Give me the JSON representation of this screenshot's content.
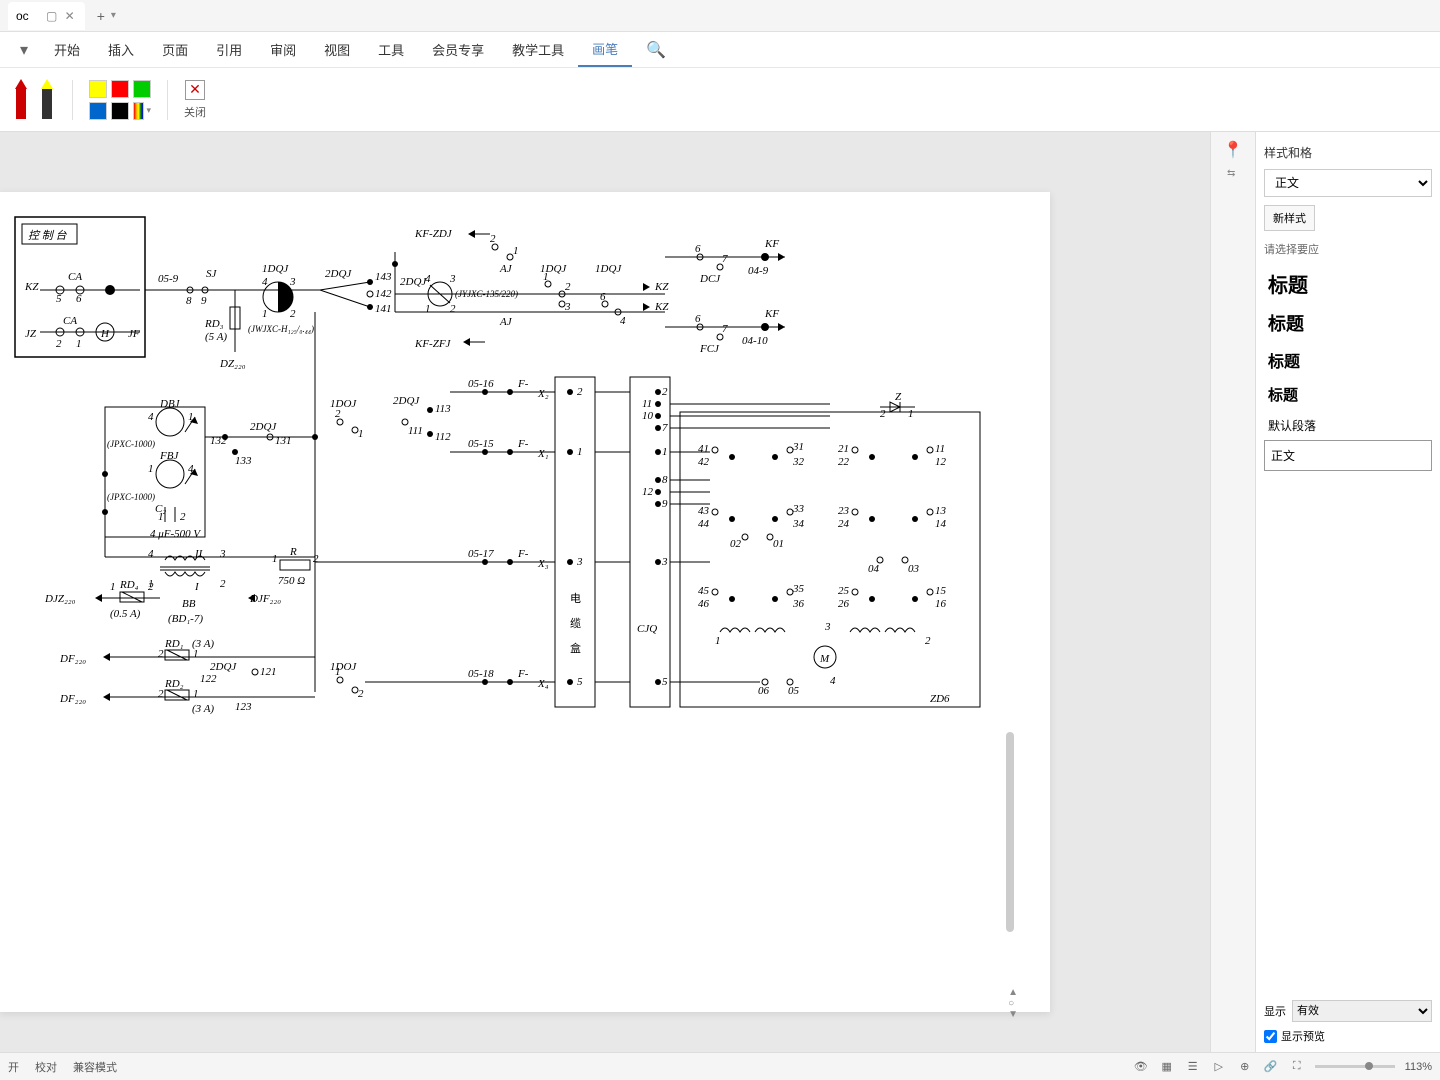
{
  "titlebar": {
    "tab_name": "oc",
    "window_minimize": "▢",
    "window_close": "✕",
    "new_tab": "+",
    "tab_menu": "▾"
  },
  "menubar": {
    "dropdown": "▾",
    "items": [
      "开始",
      "插入",
      "页面",
      "引用",
      "审阅",
      "视图",
      "工具",
      "会员专享",
      "教学工具",
      "画笔"
    ],
    "active_index": 9,
    "search": "🔍"
  },
  "toolbar": {
    "pens": [
      {
        "name": "red-pen",
        "tip": "#c00",
        "body": "#c00"
      },
      {
        "name": "highlighter",
        "tip": "#ff0",
        "body": "#333"
      }
    ],
    "colors_row1": [
      "#ffff00",
      "#ff0000",
      "#00cc00"
    ],
    "colors_row2": [
      "#0066cc",
      "#000000"
    ],
    "close_label": "关闭"
  },
  "style_panel": {
    "title": "样式和格",
    "current_style": "正文",
    "new_style_btn": "新样式",
    "hint": "请选择要应",
    "styles": [
      {
        "label": "标题",
        "cls": "h1"
      },
      {
        "label": "标题",
        "cls": "h2"
      },
      {
        "label": "标题",
        "cls": "h3"
      },
      {
        "label": "标题",
        "cls": "h4"
      },
      {
        "label": "默认段落",
        "cls": "normal"
      },
      {
        "label": "正文",
        "cls": "body"
      }
    ],
    "show_label": "显示",
    "show_value": "有效",
    "preview_cb": "显示预览",
    "preview_checked": true
  },
  "statusbar": {
    "items": [
      "开",
      "校对",
      "兼容模式"
    ],
    "zoom": "113%"
  },
  "schematic": {
    "title_box": "控 制 台",
    "labels": {
      "kz": "KZ",
      "ca": "CA",
      "jz": "JZ",
      "jf": "JF",
      "h": "H",
      "sj": "SJ",
      "rd3": "RD₃",
      "rd3_5a": "(5 A)",
      "dz220": "DZ₂₂₀",
      "jwjxc": "(JWJXC-H₁₂₅/₀.₄₄)",
      "kf_zdj": "KF-ZDJ",
      "kf_zfj": "KF-ZFJ",
      "aj": "AJ",
      "dcj": "DCJ",
      "fcj": "FCJ",
      "kf": "KF",
      "dqj1": "1DQJ",
      "dqj2": "2DQJ",
      "doj": "1DOJ",
      "jyjxc": "(JYJXC-135/220)",
      "dbj": "DBJ",
      "fbj": "FBJ",
      "jpxc": "(JPXC-1000)",
      "c2": "C₂",
      "cap": "4 μF-500 V",
      "bb": "BB",
      "bd17": "(BD₁-7)",
      "r": "R",
      "r_val": "750 Ω",
      "djz": "DJZ₂₂₀",
      "djf": "DJF₂₂₀",
      "rd4": "RD₄",
      "rd4_05a": "(0.5 A)",
      "df220": "DF₂₂₀",
      "rd1": "RD₁",
      "rd2": "RD₂",
      "rd_3a": "(3 A)",
      "cable_box": "电\n缆\n盒",
      "cjq": "CJQ",
      "m": "M",
      "zd6": "ZD6",
      "z": "Z",
      "x1": "X₁",
      "x2": "X₂",
      "x3": "X₃",
      "x4": "X₄",
      "f_dash": "F-"
    },
    "terminals": {
      "t05_9": "05-9",
      "t04_9": "04-9",
      "t04_10": "04-10",
      "t05_15": "05-15",
      "t05_16": "05-16",
      "t05_17": "05-17",
      "t05_18": "05-18"
    },
    "pin_nums": [
      "1",
      "2",
      "3",
      "4",
      "5",
      "6",
      "7",
      "8",
      "9",
      "10",
      "11",
      "12",
      "13",
      "14",
      "15",
      "16",
      "21",
      "22",
      "23",
      "24",
      "25",
      "26",
      "31",
      "32",
      "33",
      "34",
      "35",
      "36",
      "41",
      "42",
      "43",
      "44",
      "45",
      "46",
      "01",
      "02",
      "03",
      "04",
      "05",
      "06",
      "111",
      "112",
      "113",
      "121",
      "122",
      "123",
      "131",
      "132",
      "133",
      "141",
      "142",
      "143"
    ]
  }
}
